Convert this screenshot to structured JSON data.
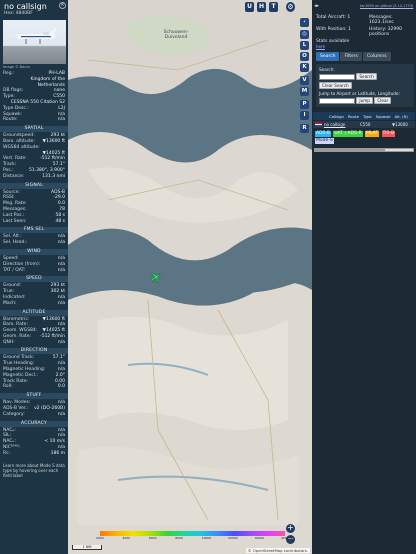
{
  "left": {
    "callsign": "no callsign",
    "hex": "Hex: 4840BF",
    "photo_credit": "Image © Baum",
    "rows_top": [
      {
        "k": "Reg.:",
        "v": "PH-LAB"
      },
      {
        "k": "",
        "v": "Kingdom of the"
      },
      {
        "k": "",
        "v": "Netherlands"
      },
      {
        "k": "DB flags:",
        "v": "none"
      },
      {
        "k": "Type:",
        "v": "C550"
      },
      {
        "k": "",
        "v": "CESSNA 550 Citation S2"
      },
      {
        "k": "Type Desc.:",
        "v": "L2J"
      },
      {
        "k": "Squawk:",
        "v": "n/a"
      },
      {
        "k": "Route:",
        "v": "n/a"
      }
    ],
    "sec_spatial": "SPATIAL",
    "spatial": [
      {
        "k": "Groundspeed:",
        "v": "293 kt"
      },
      {
        "k": "Baro. altitude:",
        "v": "▼13600 ft"
      },
      {
        "k": "WGS84 altitude:",
        "v": ""
      },
      {
        "k": "",
        "v": "▼14025 ft"
      },
      {
        "k": "Vert. Rate:",
        "v": "-512 ft/min"
      },
      {
        "k": "Track:",
        "v": "57.1°"
      },
      {
        "k": "Pos.:",
        "v": "51.380°, 3.900°"
      },
      {
        "k": "Distance:",
        "v": "131.3 nmi"
      }
    ],
    "sec_signal": "SIGNAL",
    "signal": [
      {
        "k": "Source:",
        "v": "ADS-B"
      },
      {
        "k": "RSSI:",
        "v": "-29.0"
      },
      {
        "k": "Msg. Rate:",
        "v": "0.0"
      },
      {
        "k": "Messages:",
        "v": "78"
      },
      {
        "k": "Last Pos.:",
        "v": "58 s"
      },
      {
        "k": "Last Seen:",
        "v": "48 s"
      }
    ],
    "sec_fms": "FMS SEL",
    "fms": [
      {
        "k": "Sel. Alt.:",
        "v": "n/a"
      },
      {
        "k": "Sel. Head.:",
        "v": "n/a"
      }
    ],
    "sec_wind": "WIND",
    "wind": [
      {
        "k": "Speed:",
        "v": "n/a"
      },
      {
        "k": "Direction (from):",
        "v": "n/a"
      },
      {
        "k": "TAT / OAT:",
        "v": "n/a"
      }
    ],
    "sec_speed": "SPEED",
    "speed": [
      {
        "k": "Ground:",
        "v": "293 kt"
      },
      {
        "k": "True:",
        "v": "302 kt"
      },
      {
        "k": "Indicated:",
        "v": "n/a"
      },
      {
        "k": "Mach:",
        "v": "n/a"
      }
    ],
    "sec_altitude": "ALTITUDE",
    "altitude": [
      {
        "k": "Barometric:",
        "v": "▼13600 ft"
      },
      {
        "k": "Baro. Rate:",
        "v": "n/a"
      },
      {
        "k": "Geom. WGS84:",
        "v": "▼14025 ft"
      },
      {
        "k": "Geom. Rate:",
        "v": "-512 ft/min"
      },
      {
        "k": "QNH:",
        "v": "n/a"
      }
    ],
    "sec_direction": "DIRECTION",
    "direction": [
      {
        "k": "Ground Track:",
        "v": "57.1°"
      },
      {
        "k": "True Heading:",
        "v": "n/a"
      },
      {
        "k": "Magnetic Heading:",
        "v": "n/a"
      },
      {
        "k": "Magnetic Decl.:",
        "v": "2.0°"
      },
      {
        "k": "Track Rate:",
        "v": "0.00"
      },
      {
        "k": "Roll:",
        "v": "0.0"
      }
    ],
    "sec_stuff": "STUFF",
    "stuff": [
      {
        "k": "Nav. Modes:",
        "v": "n/a"
      },
      {
        "k": "ADS-B Ver.:",
        "v": "v2 (DO-260B)"
      },
      {
        "k": "Category:",
        "v": "n/a"
      }
    ],
    "sec_accuracy": "ACCURACY",
    "accuracy": [
      {
        "k": "NACₚ:",
        "v": "n/a"
      },
      {
        "k": "SIL:",
        "v": "n/a"
      },
      {
        "k": "NACᵥ:",
        "v": "< 10 m/s"
      },
      {
        "k": "NICᴮᴬᴿᴼ:",
        "v": "n/a"
      },
      {
        "k": "Rc:",
        "v": "186 m"
      }
    ],
    "learn_more": "Learn more about Mode S data type by hovering over each field label"
  },
  "map": {
    "top_buttons": [
      "U",
      "H",
      "T"
    ],
    "side_buttons": [
      "L",
      "O",
      "K",
      "V",
      "M",
      "P",
      "I",
      "R"
    ],
    "places": {
      "p1": "Schouwen-Duiveland"
    },
    "scale": "1 NM",
    "attribution": "© OpenStreetMap contributors.",
    "zoom_in": "+",
    "zoom_out": "−",
    "colorbar_labels": [
      "2000",
      "4000",
      "6000",
      "8000",
      "10000",
      "20000",
      "30000",
      "40000+"
    ],
    "aircraft_color": "#3bd46b"
  },
  "right": {
    "toplink": "tar1090 on github (3.14.1753)",
    "stats": {
      "total_label": "Total Aircraft: 1",
      "messages_label": "Messages:",
      "messages_value": "1623.1/sec",
      "with_pos_label": "With Position: 1",
      "history_label": "History: 32990",
      "history_value": "positions",
      "stats_label": "Stats available",
      "stats_link": "here"
    },
    "tabs": [
      "Search",
      "Filters",
      "Columns"
    ],
    "search": {
      "search_label": "Search:",
      "search_button": "Search",
      "clear_button": "Clear Search",
      "jump_label": "Jump to Airport or Latitude, Longitude:",
      "jump_button": "Jump",
      "clear2_button": "Clear"
    },
    "table": {
      "headers": [
        "",
        "Callsign",
        "Route",
        "Type",
        "Squawk",
        "Alt. (ft)"
      ],
      "row": {
        "flag": "nl",
        "callsign": "no callsign",
        "type": "C550",
        "alt": "▼13600"
      }
    },
    "badges": [
      {
        "label": "ADS-B",
        "color": "#1fb8ff"
      },
      {
        "label": "UAT / ADS-R",
        "color": "#39d639"
      },
      {
        "label": "MLAT",
        "color": "#ffaa00"
      },
      {
        "label": "TIS-B",
        "color": "#ff4f4f"
      }
    ],
    "modes_label": "Mode-S",
    "modes_color": "#cfd5ff"
  }
}
